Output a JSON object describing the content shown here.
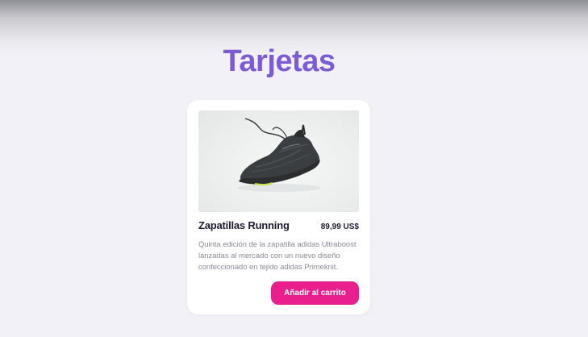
{
  "page": {
    "title": "Tarjetas"
  },
  "card": {
    "image_alt": "Zapatilla running negra",
    "name": "Zapatillas Running",
    "price": "89,99 US$",
    "description": "Quinta edición de la zapatilla adidas Ultraboost lanzadas al mercado con un nuevo diseño confeccionado en tejido adidas Primeknit.",
    "button_label": "Añadir al carrito"
  },
  "colors": {
    "title": "#7b5cd6",
    "button": "#ea1f8e",
    "background": "#f2f1f7",
    "card": "#ffffff",
    "text_dark": "#1c1a33",
    "text_muted": "#8a8a96"
  }
}
